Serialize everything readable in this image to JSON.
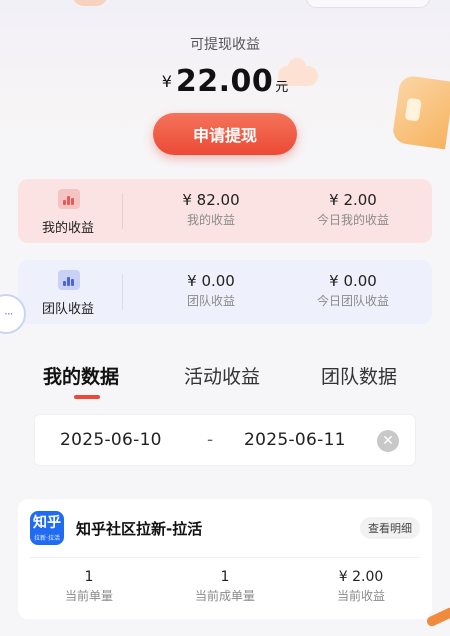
{
  "withdraw": {
    "label": "可提现收益",
    "currency": "¥",
    "amount": "22.00",
    "unit": "元",
    "button": "申请提现"
  },
  "my_card": {
    "title": "我的收益",
    "icon": "chart-icon",
    "total_value": "¥ 82.00",
    "total_label": "我的收益",
    "today_value": "¥ 2.00",
    "today_label": "今日我的收益"
  },
  "team_card": {
    "title": "团队收益",
    "icon": "chart-icon",
    "total_value": "¥ 0.00",
    "total_label": "团队收益",
    "today_value": "¥ 0.00",
    "today_label": "今日团队收益"
  },
  "tabs": [
    {
      "label": "我的数据",
      "active": true
    },
    {
      "label": "活动收益",
      "active": false
    },
    {
      "label": "团队数据",
      "active": false
    }
  ],
  "date_range": {
    "start": "2025-06-10",
    "separator": "-",
    "end": "2025-06-11",
    "clear_icon": "close-icon"
  },
  "task": {
    "logo_text": "知乎",
    "logo_sub": "拉新·拉活",
    "title": "知乎社区拉新-拉活",
    "detail_button": "查看明细",
    "stats": [
      {
        "value": "1",
        "label": "当前单量"
      },
      {
        "value": "1",
        "label": "当前成单量"
      },
      {
        "value": "¥ 2.00",
        "label": "当前收益"
      }
    ]
  },
  "side_bubble": {
    "text": "···"
  },
  "colors": {
    "accent": "#ec4a36",
    "my_card_bg": "#fbe3e3",
    "team_card_bg": "#eef1fb",
    "logo_blue": "#1f6bf2"
  }
}
